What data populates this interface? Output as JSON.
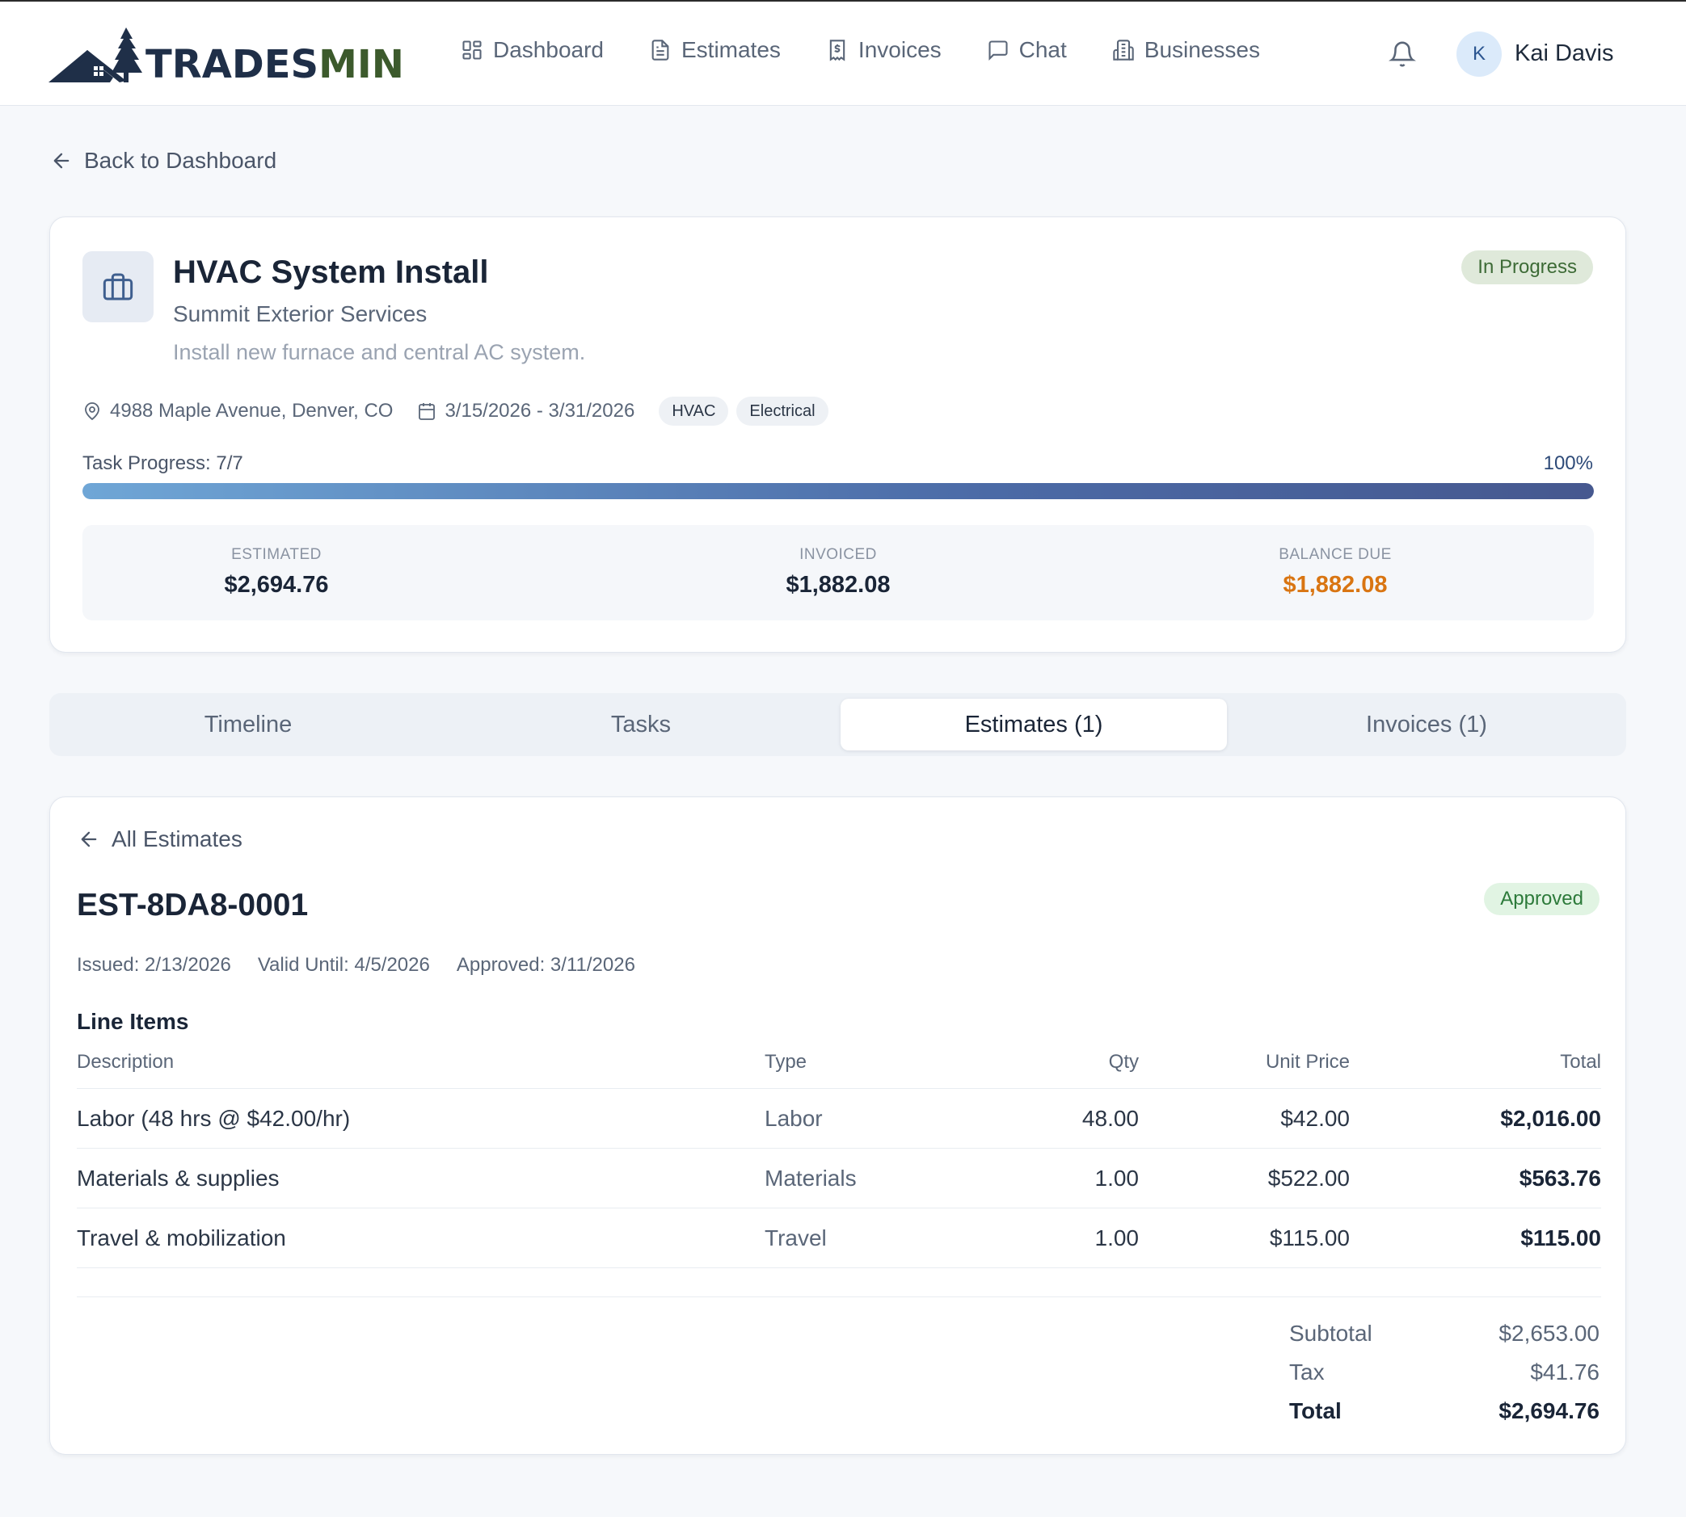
{
  "brand": {
    "name_part1": "TRADES",
    "name_part2": "MIN",
    "colors": {
      "navy": "#1f2f48",
      "green": "#3c5a2c"
    }
  },
  "nav": {
    "items": [
      {
        "label": "Dashboard",
        "icon": "grid-icon"
      },
      {
        "label": "Estimates",
        "icon": "document-icon"
      },
      {
        "label": "Invoices",
        "icon": "receipt-icon"
      },
      {
        "label": "Chat",
        "icon": "chat-icon"
      },
      {
        "label": "Businesses",
        "icon": "building-icon"
      }
    ],
    "notifications_icon": "bell-icon",
    "user": {
      "initial": "K",
      "name": "Kai Davis"
    }
  },
  "back_link": "Back to Dashboard",
  "project": {
    "title": "HVAC System Install",
    "company": "Summit Exterior Services",
    "description": "Install new furnace and central AC system.",
    "status": "In Progress",
    "address": "4988 Maple Avenue, Denver, CO",
    "date_range": "3/15/2026 - 3/31/2026",
    "tags": [
      "HVAC",
      "Electrical"
    ],
    "progress": {
      "label": "Task Progress: 7/7",
      "percent_label": "100%",
      "fraction": 1.0
    },
    "summary": {
      "estimated": {
        "label": "ESTIMATED",
        "value": "$2,694.76"
      },
      "invoiced": {
        "label": "INVOICED",
        "value": "$1,882.08"
      },
      "balance_due": {
        "label": "BALANCE DUE",
        "value": "$1,882.08",
        "color": "#d97512"
      }
    }
  },
  "tabs": [
    {
      "label": "Timeline",
      "active": false
    },
    {
      "label": "Tasks",
      "active": false
    },
    {
      "label": "Estimates (1)",
      "active": true
    },
    {
      "label": "Invoices (1)",
      "active": false
    }
  ],
  "estimate": {
    "back_label": "All Estimates",
    "number": "EST-8DA8-0001",
    "status": "Approved",
    "issued": "Issued: 2/13/2026",
    "valid_until": "Valid Until: 4/5/2026",
    "approved": "Approved: 3/11/2026",
    "line_items_title": "Line Items",
    "columns": {
      "description": "Description",
      "type": "Type",
      "qty": "Qty",
      "unit_price": "Unit Price",
      "total": "Total"
    },
    "rows": [
      {
        "description": "Labor (48 hrs @ $42.00/hr)",
        "type": "Labor",
        "qty": "48.00",
        "unit_price": "$42.00",
        "total": "$2,016.00"
      },
      {
        "description": "Materials & supplies",
        "type": "Materials",
        "qty": "1.00",
        "unit_price": "$522.00",
        "total": "$563.76"
      },
      {
        "description": "Travel & mobilization",
        "type": "Travel",
        "qty": "1.00",
        "unit_price": "$115.00",
        "total": "$115.00"
      }
    ],
    "totals": {
      "subtotal_label": "Subtotal",
      "subtotal": "$2,653.00",
      "tax_label": "Tax",
      "tax": "$41.76",
      "total_label": "Total",
      "total": "$2,694.76"
    }
  }
}
